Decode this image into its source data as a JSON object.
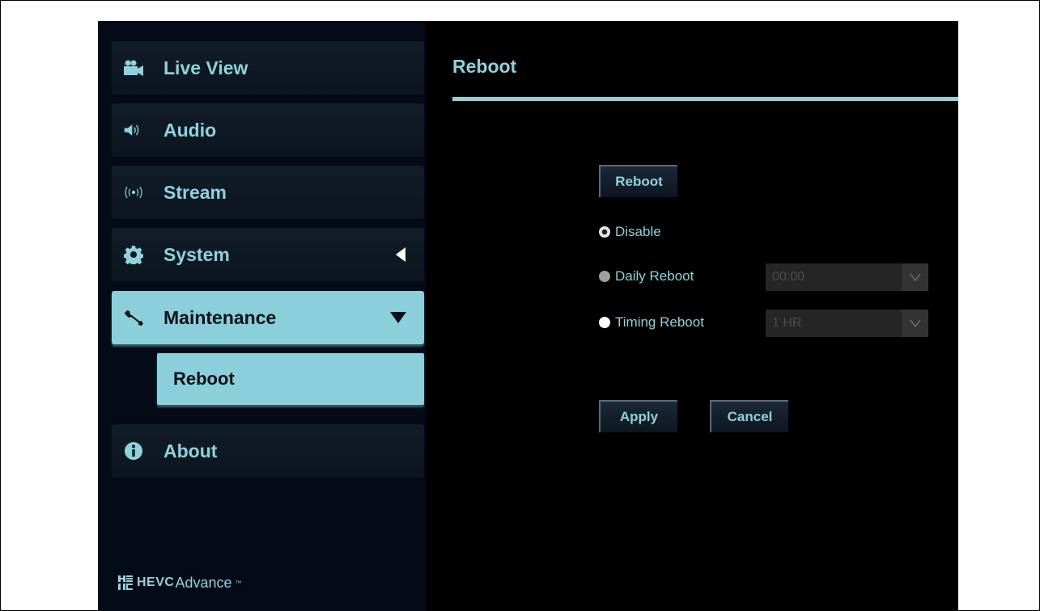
{
  "sidebar": {
    "items": [
      {
        "label": "Live View",
        "icon": "video-camera-icon"
      },
      {
        "label": "Audio",
        "icon": "speaker-icon"
      },
      {
        "label": "Stream",
        "icon": "broadcast-icon"
      },
      {
        "label": "System",
        "icon": "gear-icon"
      },
      {
        "label": "Maintenance",
        "icon": "wrench-icon"
      },
      {
        "label": "About",
        "icon": "info-icon"
      }
    ],
    "sub_item": {
      "label": "Reboot"
    },
    "logo": {
      "hevc": "HEVC",
      "advance": "Advance",
      "tm": "™"
    }
  },
  "main": {
    "title": "Reboot",
    "reboot_button": "Reboot",
    "options": [
      {
        "label": "Disable",
        "state": "checked"
      },
      {
        "label": "Daily Reboot",
        "state": "disabled",
        "select_value": "00:00"
      },
      {
        "label": "Timing Reboot",
        "state": "enabled",
        "select_value": "1 HR"
      }
    ],
    "apply_button": "Apply",
    "cancel_button": "Cancel"
  },
  "colors": {
    "accent": "#8fd2dc",
    "active_bg": "#8acfd9",
    "background": "#000000",
    "sidebar_bg": "#050a17"
  }
}
